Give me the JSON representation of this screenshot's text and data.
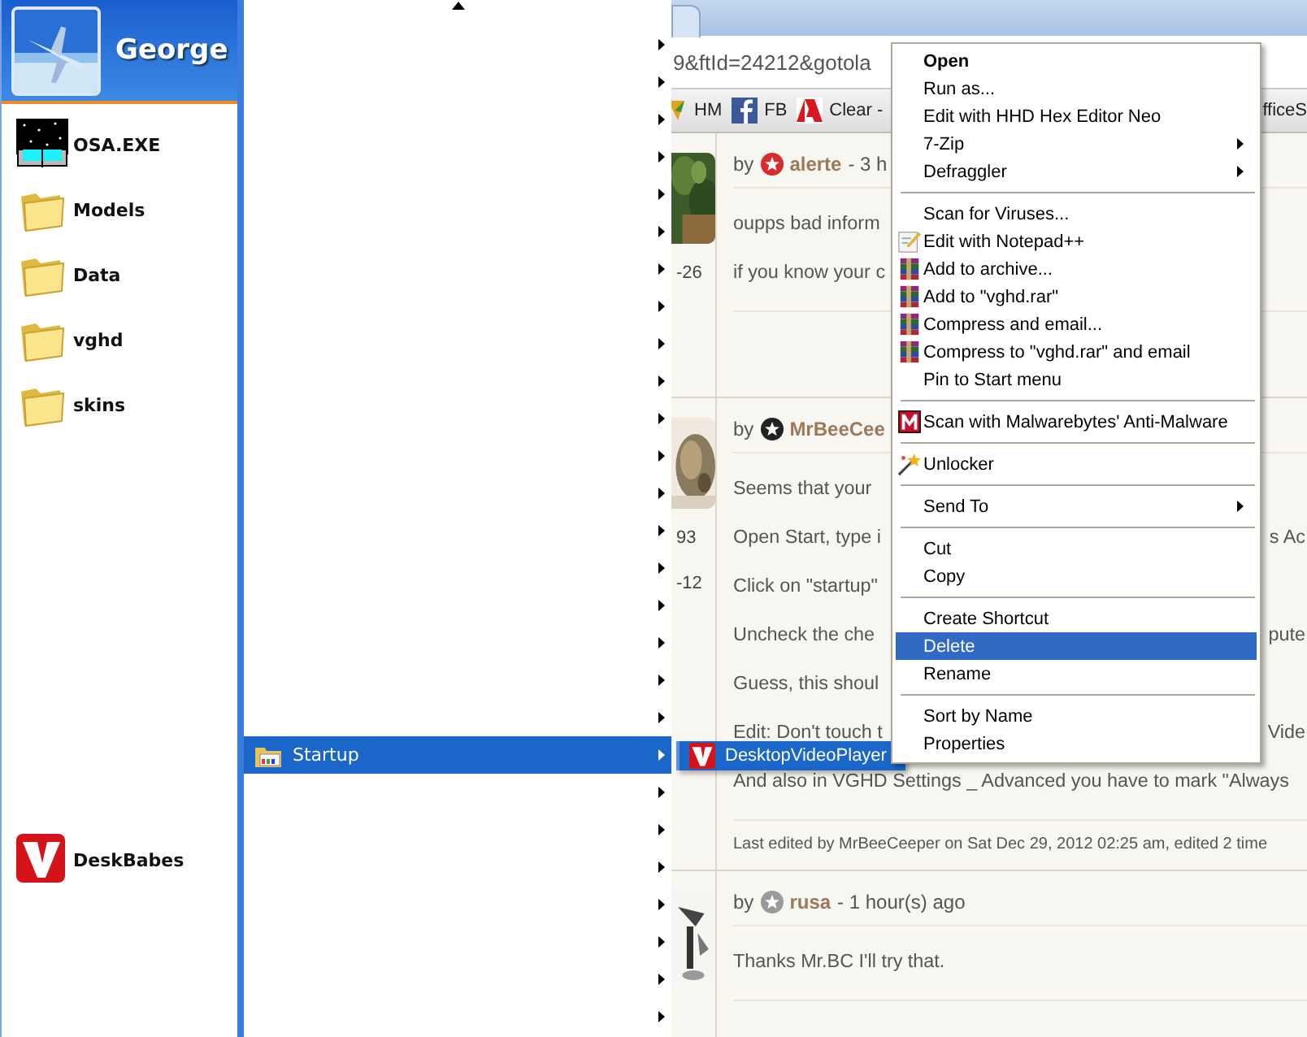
{
  "start_menu": {
    "user": "George",
    "items": [
      {
        "label": "OSA.EXE"
      },
      {
        "label": "Models"
      },
      {
        "label": "Data"
      },
      {
        "label": "vghd"
      },
      {
        "label": "skins"
      }
    ],
    "lower_items": [
      {
        "label": "DeskBabes"
      }
    ]
  },
  "programs_menu": {
    "items": [
      {
        "kind": "blank",
        "selected": false
      },
      {
        "kind": "blank",
        "selected": false
      },
      {
        "kind": "blank",
        "selected": false
      },
      {
        "kind": "blank",
        "selected": false
      },
      {
        "kind": "blank",
        "selected": false
      },
      {
        "kind": "blank",
        "selected": false
      },
      {
        "kind": "blank",
        "selected": false
      },
      {
        "kind": "blank",
        "selected": false
      },
      {
        "kind": "blank",
        "selected": false
      },
      {
        "kind": "blank",
        "selected": false
      },
      {
        "kind": "blank",
        "selected": false
      },
      {
        "kind": "blank",
        "selected": false
      },
      {
        "kind": "blank",
        "selected": false
      },
      {
        "kind": "blank",
        "selected": false
      },
      {
        "kind": "blank",
        "selected": false
      },
      {
        "kind": "blank",
        "selected": false
      },
      {
        "kind": "blank",
        "selected": false
      },
      {
        "kind": "blank",
        "selected": false
      },
      {
        "kind": "blank",
        "selected": false
      },
      {
        "kind": "folder",
        "label": "Startup",
        "selected": true
      },
      {
        "kind": "blank",
        "selected": false
      },
      {
        "kind": "blank",
        "selected": false
      },
      {
        "kind": "blank",
        "selected": false
      },
      {
        "kind": "blank",
        "selected": false
      },
      {
        "kind": "blank",
        "selected": false
      },
      {
        "kind": "blank",
        "selected": false
      },
      {
        "kind": "blank",
        "selected": false
      }
    ]
  },
  "submenu": {
    "items": [
      {
        "label": "DesktopVideoPlayer",
        "selected": true
      }
    ]
  },
  "context_menu": {
    "items": [
      {
        "kind": "item",
        "label": "Open",
        "default": true,
        "submenu": false,
        "selected": false
      },
      {
        "kind": "item",
        "label": "Run as...",
        "default": false,
        "submenu": false,
        "selected": false
      },
      {
        "kind": "item",
        "label": "Edit with HHD Hex Editor Neo",
        "default": false,
        "submenu": false,
        "selected": false
      },
      {
        "kind": "item",
        "label": "7-Zip",
        "default": false,
        "submenu": true,
        "selected": false
      },
      {
        "kind": "item",
        "label": "Defraggler",
        "default": false,
        "submenu": true,
        "selected": false
      },
      {
        "kind": "separator"
      },
      {
        "kind": "item",
        "label": "Scan for Viruses...",
        "default": false,
        "submenu": false,
        "selected": false
      },
      {
        "kind": "item",
        "label": "Edit with Notepad++",
        "default": false,
        "submenu": false,
        "selected": false
      },
      {
        "kind": "item",
        "label": "Add to archive...",
        "default": false,
        "submenu": false,
        "selected": false
      },
      {
        "kind": "item",
        "label": "Add to \"vghd.rar\"",
        "default": false,
        "submenu": false,
        "selected": false
      },
      {
        "kind": "item",
        "label": "Compress and email...",
        "default": false,
        "submenu": false,
        "selected": false
      },
      {
        "kind": "item",
        "label": "Compress to \"vghd.rar\" and email",
        "default": false,
        "submenu": false,
        "selected": false
      },
      {
        "kind": "item",
        "label": "Pin to Start menu",
        "default": false,
        "submenu": false,
        "selected": false
      },
      {
        "kind": "separator"
      },
      {
        "kind": "item",
        "label": "Scan with Malwarebytes' Anti-Malware",
        "default": false,
        "submenu": false,
        "selected": false
      },
      {
        "kind": "separator"
      },
      {
        "kind": "item",
        "label": "Unlocker",
        "default": false,
        "submenu": false,
        "selected": false
      },
      {
        "kind": "separator"
      },
      {
        "kind": "item",
        "label": "Send To",
        "default": false,
        "submenu": true,
        "selected": false
      },
      {
        "kind": "separator"
      },
      {
        "kind": "item",
        "label": "Cut",
        "default": false,
        "submenu": false,
        "selected": false
      },
      {
        "kind": "item",
        "label": "Copy",
        "default": false,
        "submenu": false,
        "selected": false
      },
      {
        "kind": "separator"
      },
      {
        "kind": "item",
        "label": "Create Shortcut",
        "default": false,
        "submenu": false,
        "selected": false
      },
      {
        "kind": "item",
        "label": "Delete",
        "default": false,
        "submenu": false,
        "selected": true
      },
      {
        "kind": "item",
        "label": "Rename",
        "default": false,
        "submenu": false,
        "selected": false
      },
      {
        "kind": "separator"
      },
      {
        "kind": "item",
        "label": "Sort by Name",
        "default": false,
        "submenu": false,
        "selected": false
      },
      {
        "kind": "item",
        "label": "Properties",
        "default": false,
        "submenu": false,
        "selected": false
      }
    ]
  },
  "browser": {
    "address": "9&ftId=24212&gotola",
    "bookmarks": [
      {
        "label": "HM"
      },
      {
        "label": "FB"
      },
      {
        "label": "Clear -"
      },
      {
        "label": "fficeS"
      }
    ],
    "posts": [
      {
        "by_label": "by",
        "author": "alerte",
        "color": "#d92b2b",
        "meta": "- 3 h",
        "stats": [
          "-26"
        ],
        "lines": [
          {
            "text": "oupps bad inform"
          },
          {
            "text": "if you know your c"
          }
        ]
      },
      {
        "by_label": "by",
        "author": "MrBeeCee",
        "color": "#222222",
        "stats": [
          "93",
          "-12"
        ],
        "lines": [
          {
            "text": "Seems that your"
          },
          {
            "text": "Open Start, type i",
            "text_after_menu": "s Ac"
          },
          {
            "text": "Click on \"startup\""
          },
          {
            "text": "Uncheck the che",
            "text_after_menu": "pute"
          },
          {
            "text": "Guess, this shoul"
          },
          {
            "text": "Edit: Don't touch t",
            "text_after_menu": "Vide"
          },
          {
            "text": "And also in VGHD Settings _ Advanced you have to mark \"Always"
          }
        ],
        "footer": "Last edited by MrBeeCeeper on Sat Dec 29, 2012 02:25 am, edited 2 time"
      },
      {
        "by_label": "by",
        "author": "rusa",
        "color": "#9a9a9a",
        "meta": "- 1 hour(s) ago",
        "lines": [
          {
            "text": "Thanks Mr.BC I'll try that."
          }
        ]
      }
    ]
  }
}
